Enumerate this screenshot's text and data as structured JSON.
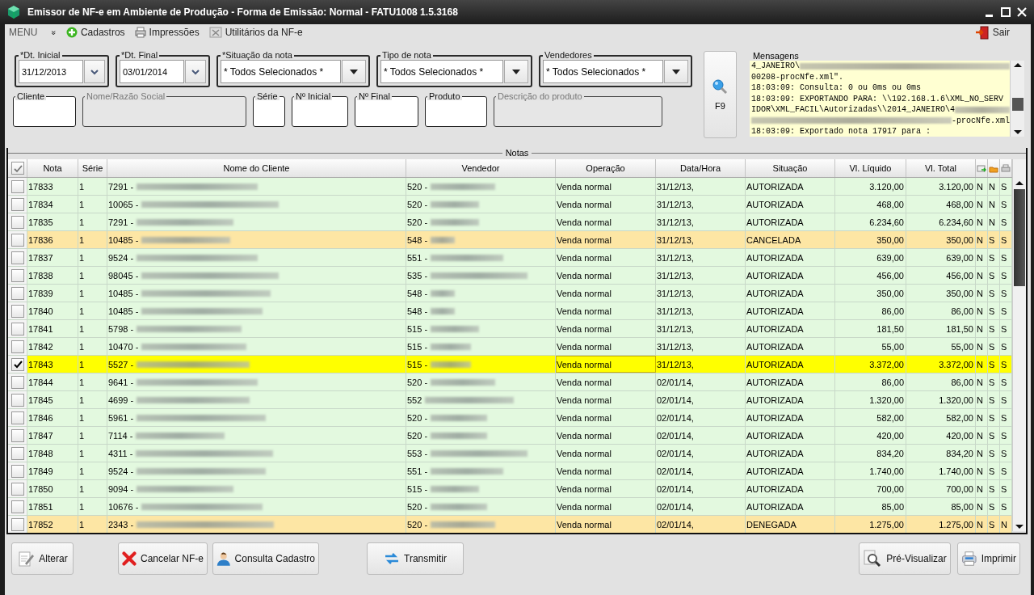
{
  "window": {
    "title": "Emissor de NF-e em Ambiente de Produção - Forma de Emissão: Normal  - FATU1008 1.5.3168"
  },
  "menu": {
    "label": "MENU",
    "expander": "»",
    "items": [
      {
        "label": "Cadastros",
        "kind": "plus"
      },
      {
        "label": "Impressões",
        "kind": "printer"
      },
      {
        "label": "Utilitários da NF-e",
        "kind": "tools"
      }
    ],
    "exit": "Sair"
  },
  "filters": [
    {
      "label": "*Dt. Inicial",
      "value": "31/12/2013",
      "kind": "date"
    },
    {
      "label": "*Dt. Final",
      "value": "03/01/2014",
      "kind": "date"
    },
    {
      "label": "*Situação da nota",
      "value": "* Todos Selecionados *",
      "kind": "combo"
    },
    {
      "label": "Tipo de nota",
      "value": "* Todos Selecionados *",
      "kind": "combo"
    },
    {
      "label": "Vendedores",
      "value": "* Todos Selecionados *",
      "kind": "combo"
    }
  ],
  "fields": [
    {
      "label": "Cliente",
      "disabled": false
    },
    {
      "label": "Nome/Razão Social",
      "disabled": true
    },
    {
      "label": "Série",
      "disabled": false
    },
    {
      "label": "Nº Inicial",
      "disabled": false
    },
    {
      "label": "Nº Final",
      "disabled": false
    },
    {
      "label": "Produto",
      "disabled": false
    },
    {
      "label": "Descrição do produto",
      "disabled": true
    }
  ],
  "search_button": {
    "label": "F9"
  },
  "messages": {
    "title": "Mensagens",
    "lines": [
      [
        {
          "kind": "text",
          "text": "4_JANEIRO\\"
        },
        {
          "kind": "redacted"
        }
      ],
      [
        {
          "kind": "text",
          "text": "00208-procNfe.xml\"."
        }
      ],
      [
        {
          "kind": "text",
          "text": "18:03:09: Consulta: 0 ou 0ms ou 0ms"
        }
      ],
      [
        {
          "kind": "text",
          "text": "18:03:09: EXPORTANDO PARA: \\\\192.168.1.6\\XML_NO_SERV"
        }
      ],
      [
        {
          "kind": "text",
          "text": "IDOR\\XML_FACIL\\Autorizadas\\\\2014_JANEIRO\\4"
        },
        {
          "kind": "redacted"
        }
      ],
      [
        {
          "kind": "redacted"
        },
        {
          "kind": "text",
          "text": "-procNfe.xml"
        }
      ],
      [
        {
          "kind": "text",
          "text": "18:03:09: Exportado nota 17917 para :"
        }
      ]
    ]
  },
  "table": {
    "title": "Notas",
    "all_checked": true,
    "columns": [
      "Nota",
      "Série",
      "Nome do Cliente",
      "Vendedor",
      "Operação",
      "Data/Hora",
      "Situação",
      "Vl. Líquido",
      "Vl. Total"
    ],
    "rows": [
      {
        "nota": "17833",
        "serie": "1",
        "cliente": "7291 -",
        "vendedor": "520 -",
        "operacao": "Venda normal",
        "data": "31/12/13,",
        "situacao": "AUTORIZADA",
        "liquido": "3.120,00",
        "total": "3.120,00",
        "flags": [
          "N",
          "N",
          "S"
        ],
        "checked": false,
        "selected": false,
        "color": "#e3f9df"
      },
      {
        "nota": "17834",
        "serie": "1",
        "cliente": "10065 -",
        "vendedor": "520 -",
        "operacao": "Venda normal",
        "data": "31/12/13,",
        "situacao": "AUTORIZADA",
        "liquido": "468,00",
        "total": "468,00",
        "flags": [
          "N",
          "N",
          "S"
        ],
        "checked": false,
        "selected": false,
        "color": "#e3f9df"
      },
      {
        "nota": "17835",
        "serie": "1",
        "cliente": "7291 -",
        "vendedor": "520 -",
        "operacao": "Venda normal",
        "data": "31/12/13,",
        "situacao": "AUTORIZADA",
        "liquido": "6.234,60",
        "total": "6.234,60",
        "flags": [
          "N",
          "N",
          "S"
        ],
        "checked": false,
        "selected": false,
        "color": "#e3f9df"
      },
      {
        "nota": "17836",
        "serie": "1",
        "cliente": "10485 -",
        "vendedor": "548 -",
        "operacao": "Venda normal",
        "data": "31/12/13,",
        "situacao": "CANCELADA",
        "liquido": "350,00",
        "total": "350,00",
        "flags": [
          "N",
          "S",
          "S"
        ],
        "checked": false,
        "selected": false,
        "color": "#fde6a4"
      },
      {
        "nota": "17837",
        "serie": "1",
        "cliente": "9524 -",
        "vendedor": "551 -",
        "operacao": "Venda normal",
        "data": "31/12/13,",
        "situacao": "AUTORIZADA",
        "liquido": "639,00",
        "total": "639,00",
        "flags": [
          "N",
          "S",
          "S"
        ],
        "checked": false,
        "selected": false,
        "color": "#e3f9df"
      },
      {
        "nota": "17838",
        "serie": "1",
        "cliente": "98045 -",
        "vendedor": "535 -",
        "operacao": "Venda normal",
        "data": "31/12/13,",
        "situacao": "AUTORIZADA",
        "liquido": "456,00",
        "total": "456,00",
        "flags": [
          "N",
          "S",
          "S"
        ],
        "checked": false,
        "selected": false,
        "color": "#e3f9df"
      },
      {
        "nota": "17839",
        "serie": "1",
        "cliente": "10485 -",
        "vendedor": "548 -",
        "operacao": "Venda normal",
        "data": "31/12/13,",
        "situacao": "AUTORIZADA",
        "liquido": "350,00",
        "total": "350,00",
        "flags": [
          "N",
          "S",
          "S"
        ],
        "checked": false,
        "selected": false,
        "color": "#e3f9df"
      },
      {
        "nota": "17840",
        "serie": "1",
        "cliente": "10485 -",
        "vendedor": "548 -",
        "operacao": "Venda normal",
        "data": "31/12/13,",
        "situacao": "AUTORIZADA",
        "liquido": "86,00",
        "total": "86,00",
        "flags": [
          "N",
          "S",
          "S"
        ],
        "checked": false,
        "selected": false,
        "color": "#e3f9df"
      },
      {
        "nota": "17841",
        "serie": "1",
        "cliente": "5798 -",
        "vendedor": "515 -",
        "operacao": "Venda normal",
        "data": "31/12/13,",
        "situacao": "AUTORIZADA",
        "liquido": "181,50",
        "total": "181,50",
        "flags": [
          "N",
          "S",
          "S"
        ],
        "checked": false,
        "selected": false,
        "color": "#e3f9df"
      },
      {
        "nota": "17842",
        "serie": "1",
        "cliente": "10470 -",
        "vendedor": "515 -",
        "operacao": "Venda normal",
        "data": "31/12/13,",
        "situacao": "AUTORIZADA",
        "liquido": "55,00",
        "total": "55,00",
        "flags": [
          "N",
          "S",
          "S"
        ],
        "checked": false,
        "selected": false,
        "color": "#e3f9df"
      },
      {
        "nota": "17843",
        "serie": "1",
        "cliente": "5527 -",
        "vendedor": "515 -",
        "operacao": "Venda normal",
        "data": "31/12/13,",
        "situacao": "AUTORIZADA",
        "liquido": "3.372,00",
        "total": "3.372,00",
        "flags": [
          "N",
          "S",
          "S"
        ],
        "checked": true,
        "selected": true
      },
      {
        "nota": "17844",
        "serie": "1",
        "cliente": "9641 -",
        "vendedor": "520 -",
        "operacao": "Venda normal",
        "data": "02/01/14,",
        "situacao": "AUTORIZADA",
        "liquido": "86,00",
        "total": "86,00",
        "flags": [
          "N",
          "S",
          "S"
        ],
        "checked": false,
        "selected": false,
        "color": "#e3f9df"
      },
      {
        "nota": "17845",
        "serie": "1",
        "cliente": "4699 -",
        "vendedor": "552",
        "operacao": "Venda normal",
        "data": "02/01/14,",
        "situacao": "AUTORIZADA",
        "liquido": "1.320,00",
        "total": "1.320,00",
        "flags": [
          "N",
          "S",
          "S"
        ],
        "checked": false,
        "selected": false,
        "color": "#e3f9df"
      },
      {
        "nota": "17846",
        "serie": "1",
        "cliente": "5961 -",
        "vendedor": "520 -",
        "operacao": "Venda normal",
        "data": "02/01/14,",
        "situacao": "AUTORIZADA",
        "liquido": "582,00",
        "total": "582,00",
        "flags": [
          "N",
          "S",
          "S"
        ],
        "checked": false,
        "selected": false,
        "color": "#e3f9df"
      },
      {
        "nota": "17847",
        "serie": "1",
        "cliente": "7114 -",
        "vendedor": "520 -",
        "operacao": "Venda normal",
        "data": "02/01/14,",
        "situacao": "AUTORIZADA",
        "liquido": "420,00",
        "total": "420,00",
        "flags": [
          "N",
          "S",
          "S"
        ],
        "checked": false,
        "selected": false,
        "color": "#e3f9df"
      },
      {
        "nota": "17848",
        "serie": "1",
        "cliente": "4311 -",
        "vendedor": "553 -",
        "operacao": "Venda normal",
        "data": "02/01/14,",
        "situacao": "AUTORIZADA",
        "liquido": "834,20",
        "total": "834,20",
        "flags": [
          "N",
          "S",
          "S"
        ],
        "checked": false,
        "selected": false,
        "color": "#e3f9df"
      },
      {
        "nota": "17849",
        "serie": "1",
        "cliente": "9524 -",
        "vendedor": "551 -",
        "operacao": "Venda normal",
        "data": "02/01/14,",
        "situacao": "AUTORIZADA",
        "liquido": "1.740,00",
        "total": "1.740,00",
        "flags": [
          "N",
          "S",
          "S"
        ],
        "checked": false,
        "selected": false,
        "color": "#e3f9df"
      },
      {
        "nota": "17850",
        "serie": "1",
        "cliente": "9094 -",
        "vendedor": "515 -",
        "operacao": "Venda normal",
        "data": "02/01/14,",
        "situacao": "AUTORIZADA",
        "liquido": "700,00",
        "total": "700,00",
        "flags": [
          "N",
          "S",
          "S"
        ],
        "checked": false,
        "selected": false,
        "color": "#e3f9df"
      },
      {
        "nota": "17851",
        "serie": "1",
        "cliente": "10676 -",
        "vendedor": "520 -",
        "operacao": "Venda normal",
        "data": "02/01/14,",
        "situacao": "AUTORIZADA",
        "liquido": "85,00",
        "total": "85,00",
        "flags": [
          "N",
          "S",
          "S"
        ],
        "checked": false,
        "selected": false,
        "color": "#e3f9df"
      },
      {
        "nota": "17852",
        "serie": "1",
        "cliente": "2343 -",
        "vendedor": "520 -",
        "operacao": "Venda normal",
        "data": "02/01/14,",
        "situacao": "DENEGADA",
        "liquido": "1.275,00",
        "total": "1.275,00",
        "flags": [
          "N",
          "S",
          "N"
        ],
        "checked": false,
        "selected": false,
        "color": "#fde6a4"
      }
    ]
  },
  "actions": [
    {
      "label": "Alterar",
      "kind": "edit"
    },
    {
      "label": "Cancelar NF-e",
      "kind": "cancel"
    },
    {
      "label": "Consulta Cadastro",
      "kind": "person"
    },
    {
      "label": "Transmitir",
      "kind": "transmit"
    },
    {
      "label": "Pré-Visualizar",
      "kind": "preview"
    },
    {
      "label": "Imprimir",
      "kind": "print"
    }
  ]
}
